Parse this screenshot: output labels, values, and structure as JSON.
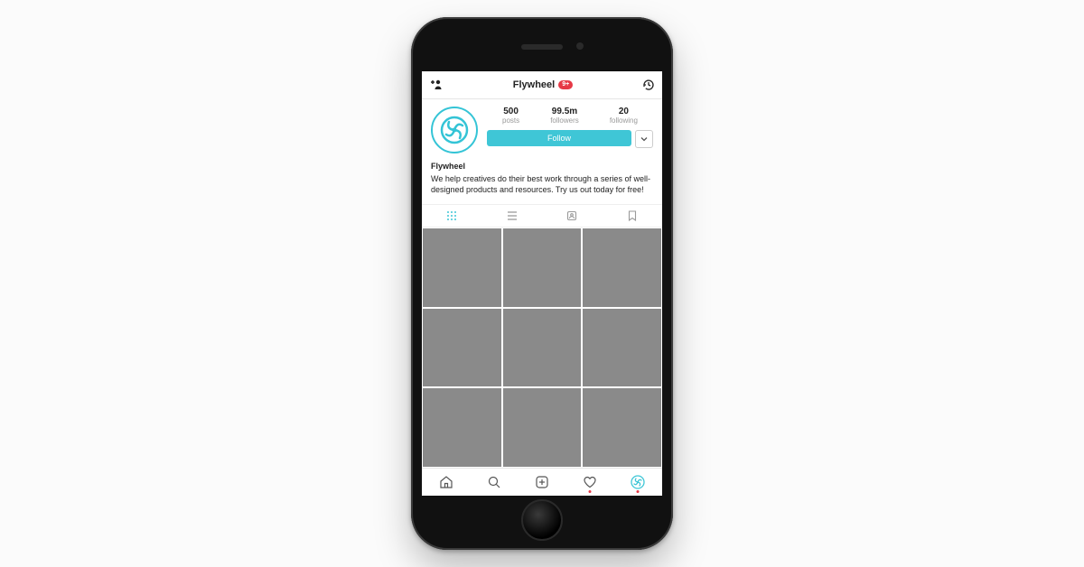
{
  "header": {
    "title": "Flywheel",
    "badge": "9+"
  },
  "profile": {
    "stats": {
      "posts": {
        "value": "500",
        "label": "posts"
      },
      "followers": {
        "value": "99.5m",
        "label": "followers"
      },
      "following": {
        "value": "20",
        "label": "following"
      }
    },
    "follow_label": "Follow",
    "bio_name": "Flywheel",
    "bio_text": "We help creatives do their best work through a series of well-designed products and resources. Try us out today for free!"
  },
  "colors": {
    "accent": "#3fc6d6",
    "badge": "#e63946",
    "placeholder": "#8a8a8a"
  }
}
